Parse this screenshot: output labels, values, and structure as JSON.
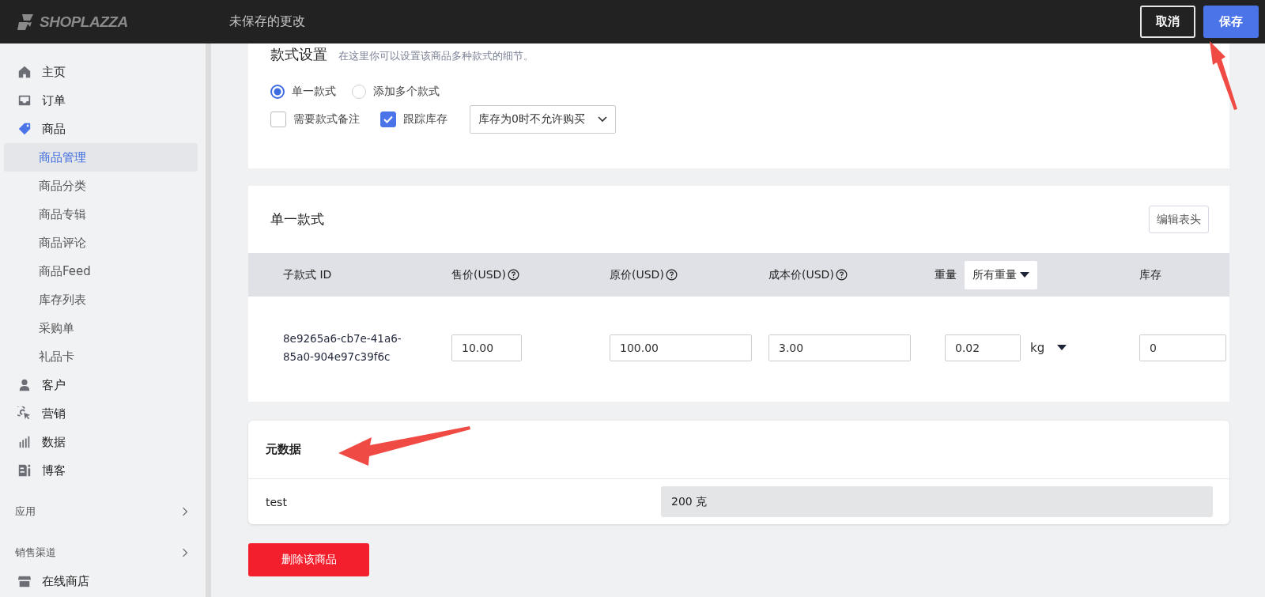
{
  "topbar": {
    "logo": "SHOPLAZZA",
    "title": "未保存的更改",
    "buttons": [
      {
        "label": "取消",
        "kind": "secondary"
      },
      {
        "label": "保存",
        "kind": "primary"
      }
    ]
  },
  "sidebar": {
    "items": [
      {
        "label": "主页",
        "selected": false
      },
      {
        "label": "订单",
        "selected": false
      },
      {
        "label": "商品",
        "selected": true,
        "children": [
          {
            "label": "商品管理",
            "selected": true
          },
          {
            "label": "商品分类",
            "selected": false
          },
          {
            "label": "商品专辑",
            "selected": false
          },
          {
            "label": "商品评论",
            "selected": false
          },
          {
            "label": "商品Feed",
            "selected": false
          },
          {
            "label": "库存列表",
            "selected": false
          },
          {
            "label": "采购单",
            "selected": false
          },
          {
            "label": "礼品卡",
            "selected": false
          }
        ]
      },
      {
        "label": "客户",
        "selected": false
      },
      {
        "label": "营销",
        "selected": false
      },
      {
        "label": "数据",
        "selected": false
      },
      {
        "label": "博客",
        "selected": false
      }
    ],
    "sections": [
      {
        "label": "应用"
      },
      {
        "label": "销售渠道",
        "items": [
          {
            "label": "在线商店",
            "selected": false
          }
        ]
      }
    ]
  },
  "variant_settings": {
    "title": "款式设置",
    "hint": "在这里你可以设置该商品多种款式的细节。",
    "options": [
      {
        "label": "单一款式",
        "selected": true
      },
      {
        "label": "添加多个款式",
        "selected": false
      }
    ],
    "checkboxes": [
      {
        "label": "需要款式备注",
        "checked": false
      },
      {
        "label": "跟踪库存",
        "checked": true
      }
    ],
    "inventory_policy": "库存为0时不允许购买"
  },
  "single_variant": {
    "title": "单一款式",
    "edit_button": "编辑表头",
    "columns": [
      {
        "label": "子款式 ID",
        "kind": "plain"
      },
      {
        "label": "售价(USD)",
        "kind": "help"
      },
      {
        "label": "原价(USD)",
        "kind": "help"
      },
      {
        "label": "成本价(USD)",
        "kind": "help"
      },
      {
        "label": "重量",
        "kind": "filter",
        "filter": "所有重量"
      },
      {
        "label": "库存",
        "kind": "plain"
      }
    ],
    "row": {
      "id": "8e9265a6-cb7e-41a6-85a0-904e97c39f6c",
      "price": "10.00",
      "compare_price": "100.00",
      "cost": "3.00",
      "weight": "0.02",
      "weight_unit": "kg",
      "stock": "0"
    }
  },
  "metafields": {
    "title": "元数据",
    "rows": [
      {
        "key": "test",
        "value": "200 克"
      }
    ]
  },
  "delete_button": "删除该商品"
}
